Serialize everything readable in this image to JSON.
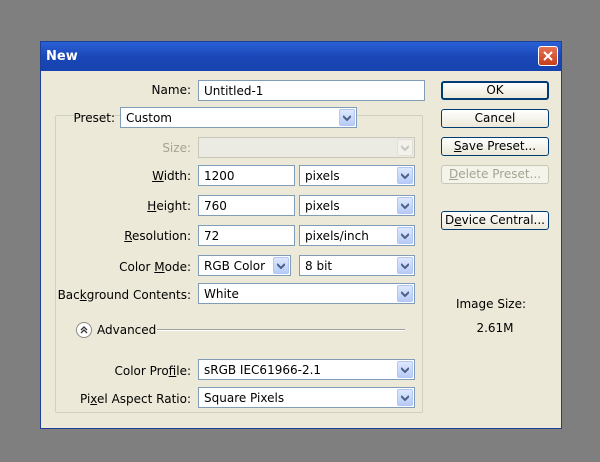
{
  "window": {
    "title": "New"
  },
  "name": {
    "label": "Name:",
    "value": "Untitled-1"
  },
  "preset": {
    "label": "Preset:",
    "value": "Custom"
  },
  "size": {
    "label": "Size:",
    "value": ""
  },
  "width": {
    "label": "Width:",
    "value": "1200",
    "unit": "pixels"
  },
  "height": {
    "label": "Height:",
    "value": "760",
    "unit": "pixels"
  },
  "resolution": {
    "label": "Resolution:",
    "value": "72",
    "unit": "pixels/inch"
  },
  "color_mode": {
    "label": "Color Mode:",
    "value": "RGB Color",
    "depth": "8 bit"
  },
  "background": {
    "label": "Background Contents:",
    "value": "White"
  },
  "advanced": {
    "label": "Advanced"
  },
  "color_profile": {
    "label": "Color Profile:",
    "value": "sRGB IEC61966-2.1"
  },
  "pixel_aspect": {
    "label": "Pixel Aspect Ratio:",
    "value": "Square Pixels"
  },
  "buttons": {
    "ok": "OK",
    "cancel": "Cancel",
    "save_preset": "Save Preset...",
    "delete_preset": "Delete Preset...",
    "device_central": "Device Central..."
  },
  "image_size": {
    "label": "Image Size:",
    "value": "2.61M"
  },
  "colors": {
    "titlebar": "#1c47b8",
    "dialog_bg": "#ece9d8",
    "desktop": "#7f7f7f"
  }
}
